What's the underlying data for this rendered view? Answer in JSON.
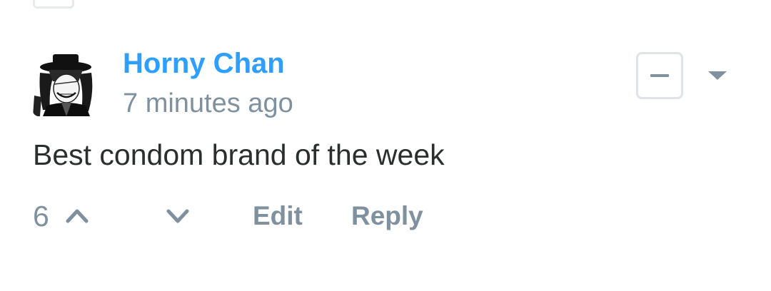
{
  "comment": {
    "author": "Horny Chan",
    "timestamp": "7 minutes ago",
    "message": "Best condom brand of the week",
    "votes": "6",
    "avatar_icon": "anime-character-avatar"
  },
  "actions": {
    "edit_label": "Edit",
    "reply_label": "Reply",
    "upvote_icon": "chevron-up-icon",
    "downvote_icon": "chevron-down-icon",
    "collapse_icon": "minus-icon",
    "menu_icon": "caret-down-icon"
  },
  "colors": {
    "author": "#2e9fff",
    "muted": "#7f919e",
    "text": "#2a2e2e",
    "border": "#dde3e8"
  }
}
